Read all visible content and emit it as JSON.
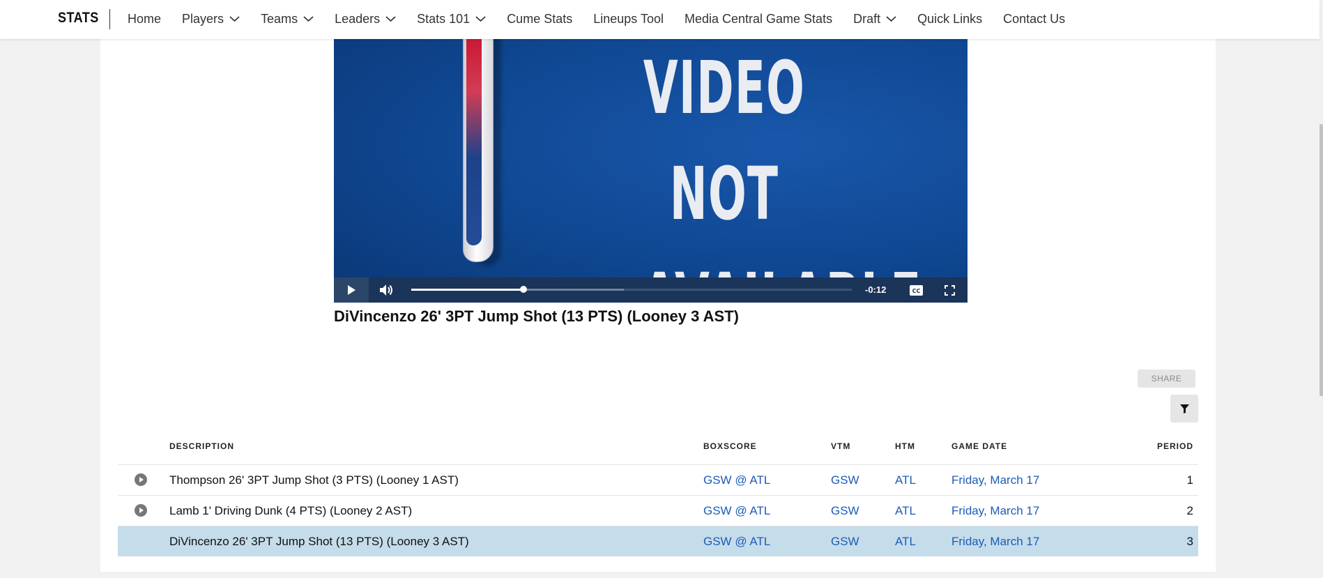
{
  "nav": {
    "brand": "STATS",
    "items": [
      {
        "label": "Home",
        "dropdown": false
      },
      {
        "label": "Players",
        "dropdown": true
      },
      {
        "label": "Teams",
        "dropdown": true
      },
      {
        "label": "Leaders",
        "dropdown": true
      },
      {
        "label": "Stats 101",
        "dropdown": true
      },
      {
        "label": "Cume Stats",
        "dropdown": false
      },
      {
        "label": "Lineups Tool",
        "dropdown": false
      },
      {
        "label": "Media Central Game Stats",
        "dropdown": false
      },
      {
        "label": "Draft",
        "dropdown": true
      },
      {
        "label": "Quick Links",
        "dropdown": false
      },
      {
        "label": "Contact Us",
        "dropdown": false
      }
    ]
  },
  "video": {
    "overlay_line1": "VIDEO NOT",
    "overlay_line2": "AVAILABLE",
    "time_remaining": "-0:12",
    "progress_fraction": 0.255,
    "caption": "DiVincenzo 26' 3PT Jump Shot (13 PTS) (Looney 3 AST)",
    "icons": {
      "play": "play-icon",
      "volume": "volume-icon",
      "cc": "closed-captions-icon",
      "fullscreen": "fullscreen-icon"
    }
  },
  "actions": {
    "share_label": "SHARE",
    "filter_icon": "filter-icon"
  },
  "table": {
    "headers": {
      "description": "DESCRIPTION",
      "boxscore": "BOXSCORE",
      "vtm": "VTM",
      "htm": "HTM",
      "game_date": "GAME DATE",
      "period": "PERIOD"
    },
    "rows": [
      {
        "description": "Thompson 26' 3PT Jump Shot (3 PTS) (Looney 1 AST)",
        "boxscore": "GSW @ ATL",
        "vtm": "GSW",
        "htm": "ATL",
        "game_date": "Friday, March 17",
        "period": "1",
        "selected": false
      },
      {
        "description": "Lamb 1' Driving Dunk (4 PTS) (Looney 2 AST)",
        "boxscore": "GSW @ ATL",
        "vtm": "GSW",
        "htm": "ATL",
        "game_date": "Friday, March 17",
        "period": "2",
        "selected": false
      },
      {
        "description": "DiVincenzo 26' 3PT Jump Shot (13 PTS) (Looney 3 AST)",
        "boxscore": "GSW @ ATL",
        "vtm": "GSW",
        "htm": "ATL",
        "game_date": "Friday, March 17",
        "period": "3",
        "selected": true
      }
    ]
  },
  "colors": {
    "link": "#1d5bb8",
    "selected_row": "#c5dcea",
    "video_bg": "#0f4791",
    "controls_bg": "#1b3459"
  }
}
